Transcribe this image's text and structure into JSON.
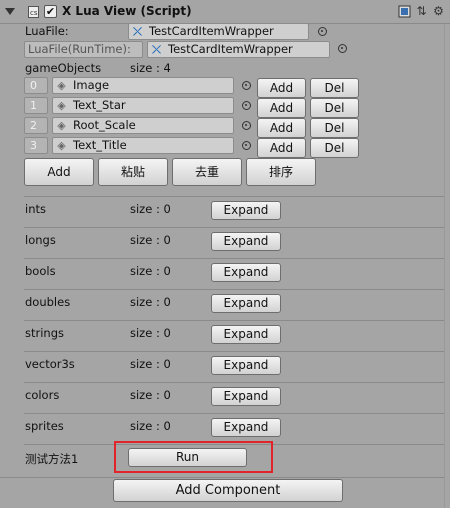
{
  "component": {
    "title": "X Lua View (Script)",
    "enabled_check": "✔",
    "icons": [
      "book-icon",
      "settings-icon",
      "gear-icon"
    ]
  },
  "lua_file": {
    "label": "LuaFile:",
    "value": "TestCardItemWrapper"
  },
  "lua_file_runtime": {
    "label": "LuaFile(RunTime):",
    "value": "TestCardItemWrapper"
  },
  "game_objects": {
    "label": "gameObjects",
    "size_text": "size : 4",
    "items": [
      {
        "index": "0",
        "name": "Image",
        "add": "Add",
        "del": "Del"
      },
      {
        "index": "1",
        "name": "Text_Star",
        "add": "Add",
        "del": "Del"
      },
      {
        "index": "2",
        "name": "Root_Scale",
        "add": "Add",
        "del": "Del"
      },
      {
        "index": "3",
        "name": "Text_Title",
        "add": "Add",
        "del": "Del"
      }
    ],
    "actions": [
      "Add",
      "粘贴",
      "去重",
      "排序"
    ]
  },
  "arrays": [
    {
      "name": "ints",
      "size": "size : 0",
      "button": "Expand"
    },
    {
      "name": "longs",
      "size": "size : 0",
      "button": "Expand"
    },
    {
      "name": "bools",
      "size": "size : 0",
      "button": "Expand"
    },
    {
      "name": "doubles",
      "size": "size : 0",
      "button": "Expand"
    },
    {
      "name": "strings",
      "size": "size : 0",
      "button": "Expand"
    },
    {
      "name": "vector3s",
      "size": "size : 0",
      "button": "Expand"
    },
    {
      "name": "colors",
      "size": "size : 0",
      "button": "Expand"
    },
    {
      "name": "sprites",
      "size": "size : 0",
      "button": "Expand"
    }
  ],
  "test_method": {
    "label": "测试方法1",
    "button": "Run"
  },
  "add_component": "Add Component",
  "colors": {
    "highlight": "#e0242a",
    "panel": "#a5a5a5",
    "lua_icon": "#1e6ab8"
  }
}
